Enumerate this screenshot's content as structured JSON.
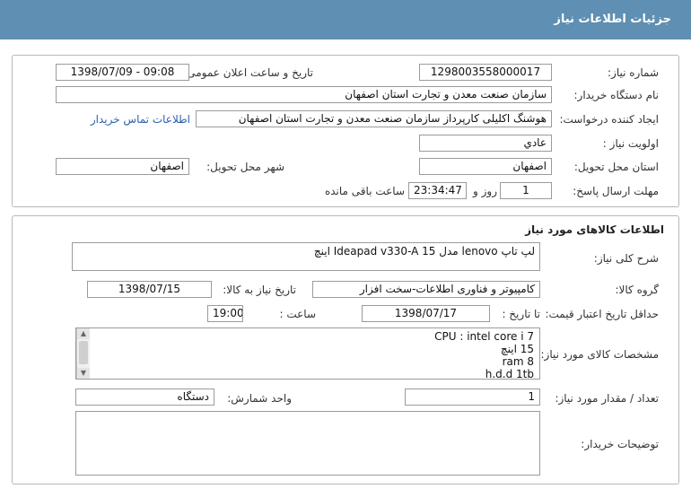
{
  "header": {
    "title": "جزئیات اطلاعات نیاز"
  },
  "need_info": {
    "need_number_label": "شماره نیاز:",
    "need_number": "1298003558000017",
    "announce_datetime_label": "تاریخ و ساعت اعلان عمومی:",
    "announce_datetime": "1398/07/09 - 09:08",
    "buyer_org_label": "نام دستگاه خریدار:",
    "buyer_org": "سازمان صنعت معدن و تجارت استان اصفهان",
    "requester_label": "ایجاد کننده درخواست:",
    "requester": "هوشنگ  اکلیلی کارپرداز سازمان صنعت معدن و تجارت استان اصفهان",
    "buyer_contact_link": "اطلاعات تماس خریدار",
    "priority_label": "اولویت نیاز :",
    "priority": "عادي",
    "delivery_province_label": "استان محل تحویل:",
    "delivery_province": "اصفهان",
    "delivery_city_label": "شهر محل تحویل:",
    "delivery_city": "اصفهان",
    "deadline_label": "مهلت ارسال پاسخ:",
    "deadline_days": "1",
    "days_label": "روز و",
    "deadline_time": "23:34:47",
    "remaining_label": "ساعت باقی مانده"
  },
  "goods": {
    "section_title": "اطلاعات کالاهای مورد نیاز",
    "general_desc_label": "شرح کلی نیاز:",
    "general_desc": "لپ تاپ lenovo مدل Ideapad v330-A  15 اینچ",
    "goods_group_label": "گروه کالا:",
    "goods_group": "کامپیوتر و فناوری اطلاعات-سخت افزار",
    "need_date_label": "تاریخ نیاز به کالا:",
    "need_date": "1398/07/15",
    "min_validity_label": "حداقل تاریخ اعتبار قیمت:",
    "until_date_label": "تا تاریخ :",
    "until_date": "1398/07/17",
    "time_label": "ساعت :",
    "time": "19:00",
    "specs_label": "مشخصات کالای مورد نیاز:",
    "specs": [
      "CPU : intel core i 7",
      "15 اینچ",
      "ram 8",
      "h.d.d 1tb"
    ],
    "quantity_label": "تعداد / مقدار مورد نیاز:",
    "quantity": "1",
    "unit_label": "واحد شمارش:",
    "unit": "دستگاه",
    "buyer_notes_label": "توضیحات خریدار:",
    "buyer_notes": ""
  },
  "colors": {
    "header_bg": "#5f8fb2",
    "link": "#2a5fb0",
    "border": "#9b9b9b"
  }
}
